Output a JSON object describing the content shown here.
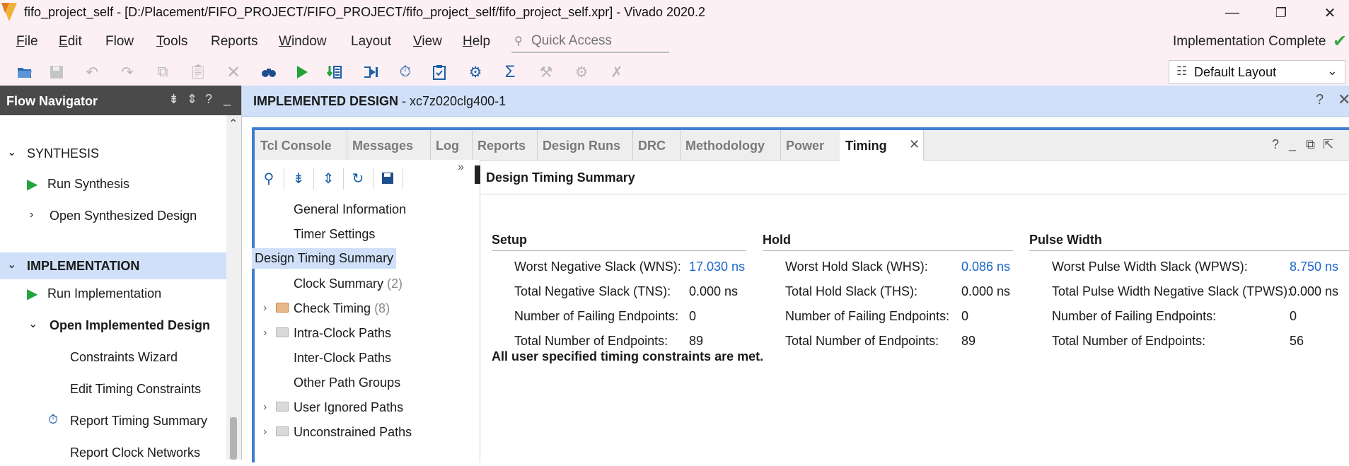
{
  "window": {
    "title": "fifo_project_self - [D:/Placement/FIFO_PROJECT/FIFO_PROJECT/fifo_project_self/fifo_project_self.xpr] - Vivado 2020.2",
    "controls": [
      "—",
      "❐",
      "✕"
    ]
  },
  "menu": {
    "items": [
      {
        "label": "File",
        "acc": "F",
        "rest": "ile"
      },
      {
        "label": "Edit",
        "acc": "E",
        "rest": "dit"
      },
      {
        "label": "Flow",
        "acc": "",
        "rest": "Flow"
      },
      {
        "label": "Tools",
        "acc": "T",
        "rest": "ools"
      },
      {
        "label": "Reports",
        "acc": "",
        "rest": "Reports"
      },
      {
        "label": "Window",
        "acc": "W",
        "rest": "indow"
      },
      {
        "label": "Layout",
        "acc": "",
        "rest": "Layout"
      },
      {
        "label": "View",
        "acc": "V",
        "rest": "iew"
      },
      {
        "label": "Help",
        "acc": "H",
        "rest": "elp"
      }
    ],
    "quick_access_placeholder": "Quick Access",
    "status": "Implementation Complete",
    "status_color": "#3aa640"
  },
  "toolbar": {
    "layout_select": "Default Layout"
  },
  "flow_navigator": {
    "title": "Flow Navigator",
    "items": {
      "synthesis": "SYNTHESIS",
      "run_synthesis": "Run Synthesis",
      "open_synth": "Open Synthesized Design",
      "implementation": "IMPLEMENTATION",
      "run_impl": "Run Implementation",
      "open_impl": "Open Implemented Design",
      "constraints_wizard": "Constraints Wizard",
      "edit_timing": "Edit Timing Constraints",
      "report_timing": "Report Timing Summary",
      "report_clock": "Report Clock Networks"
    }
  },
  "design": {
    "header_bold": "IMPLEMENTED DESIGN",
    "header_rest": " - xc7z020clg400-1"
  },
  "tabs": {
    "tcl": "Tcl Console",
    "messages": "Messages",
    "log": "Log",
    "reports": "Reports",
    "design_runs": "Design Runs",
    "drc": "DRC",
    "methodology": "Methodology",
    "power": "Power",
    "timing": "Timing"
  },
  "timing_tree": {
    "general": "General Information",
    "timer": "Timer Settings",
    "dts": "Design Timing Summary",
    "clock_summary": "Clock Summary",
    "clock_summary_count": "(2)",
    "check_timing": "Check Timing",
    "check_timing_count": "(8)",
    "intra": "Intra-Clock Paths",
    "inter": "Inter-Clock Paths",
    "other": "Other Path Groups",
    "user_ignored": "User Ignored Paths",
    "unconstrained": "Unconstrained Paths"
  },
  "summary": {
    "title": "Design Timing Summary",
    "setup": {
      "heading": "Setup",
      "wns_label": "Worst Negative Slack (WNS):",
      "wns": "17.030 ns",
      "tns_label": "Total Negative Slack (TNS):",
      "tns": "0.000 ns",
      "fail_label": "Number of Failing Endpoints:",
      "fail": "0",
      "total_label": "Total Number of Endpoints:",
      "total": "89"
    },
    "hold": {
      "heading": "Hold",
      "whs_label": "Worst Hold Slack (WHS):",
      "whs": "0.086 ns",
      "ths_label": "Total Hold Slack (THS):",
      "ths": "0.000 ns",
      "fail_label": "Number of Failing Endpoints:",
      "fail": "0",
      "total_label": "Total Number of Endpoints:",
      "total": "89"
    },
    "pulse": {
      "heading": "Pulse Width",
      "wpws_label": "Worst Pulse Width Slack (WPWS):",
      "wpws": "8.750 ns",
      "tpws_label": "Total Pulse Width Negative Slack (TPWS):",
      "tpws": "0.000 ns",
      "fail_label": "Number of Failing Endpoints:",
      "fail": "0",
      "total_label": "Total Number of Endpoints:",
      "total": "56"
    },
    "all_met": "All user specified timing constraints are met."
  }
}
